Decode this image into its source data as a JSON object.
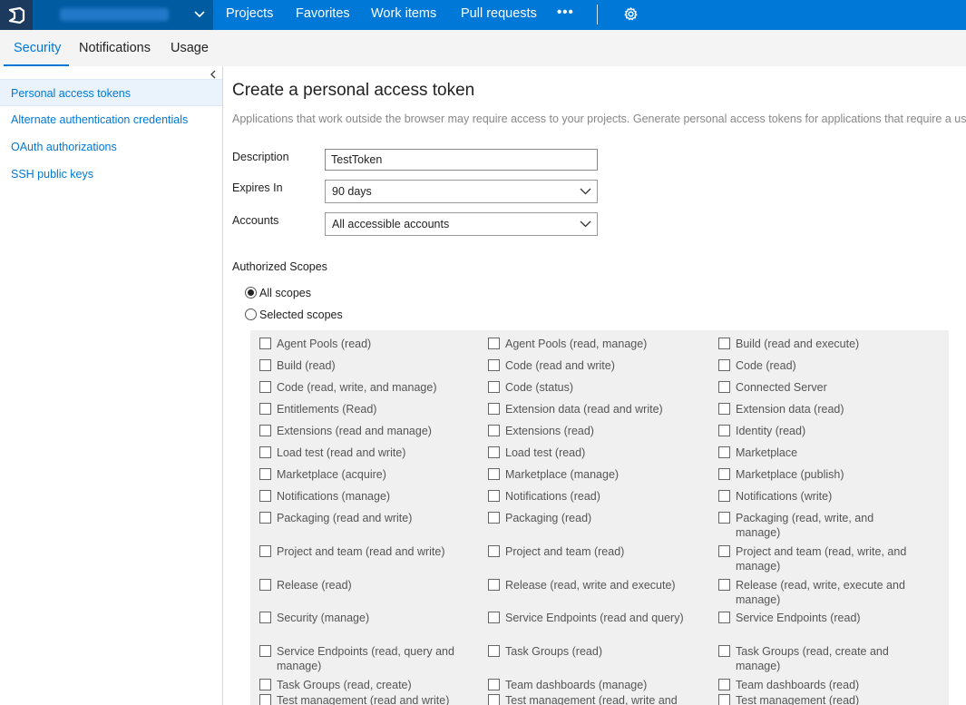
{
  "topbar": {
    "nav": [
      "Projects",
      "Favorites",
      "Work items",
      "Pull requests"
    ],
    "more_label": "•••",
    "logo_icon": "vsts-logo-icon",
    "settings_icon": "gear-icon"
  },
  "tabs": [
    "Security",
    "Notifications",
    "Usage"
  ],
  "sidebar": {
    "items": [
      "Personal access tokens",
      "Alternate authentication credentials",
      "OAuth authorizations",
      "SSH public keys"
    ]
  },
  "form": {
    "title": "Create a personal access token",
    "intro": "Applications that work outside the browser may require access to your projects. Generate personal access tokens for applications that require a username",
    "description_label": "Description",
    "description_value": "TestToken",
    "expires_label": "Expires In",
    "expires_value": "90 days",
    "accounts_label": "Accounts",
    "accounts_value": "All accessible accounts",
    "scopes_label": "Authorized Scopes",
    "all_scopes": "All scopes",
    "selected_scopes": "Selected scopes"
  },
  "scopes": [
    [
      "Agent Pools (read)",
      "Agent Pools (read, manage)",
      "Build (read and execute)"
    ],
    [
      "Build (read)",
      "Code (read and write)",
      "Code (read)"
    ],
    [
      "Code (read, write, and manage)",
      "Code (status)",
      "Connected Server"
    ],
    [
      "Entitlements (Read)",
      "Extension data (read and write)",
      "Extension data (read)"
    ],
    [
      "Extensions (read and manage)",
      "Extensions (read)",
      "Identity (read)"
    ],
    [
      "Load test (read and write)",
      "Load test (read)",
      "Marketplace"
    ],
    [
      "Marketplace (acquire)",
      "Marketplace (manage)",
      "Marketplace (publish)"
    ],
    [
      "Notifications (manage)",
      "Notifications (read)",
      "Notifications (write)"
    ],
    [
      "Packaging (read and write)",
      "Packaging (read)",
      "Packaging (read, write, and manage)"
    ],
    [
      "Project and team (read and write)",
      "Project and team (read)",
      "Project and team (read, write, and manage)"
    ],
    [
      "Release (read)",
      "Release (read, write and execute)",
      "Release (read, write, execute and manage)"
    ],
    [
      "Security (manage)",
      "Service Endpoints (read and query)",
      "Service Endpoints (read)"
    ],
    [
      "Service Endpoints (read, query and manage)",
      "Task Groups (read)",
      "Task Groups (read, create and manage)"
    ],
    [
      "Task Groups (read, create)",
      "Team dashboards (manage)",
      "Team dashboards (read)"
    ],
    [
      "Test management (read and write)",
      "Test management (read, write and manage)",
      "Test management (read)"
    ]
  ]
}
